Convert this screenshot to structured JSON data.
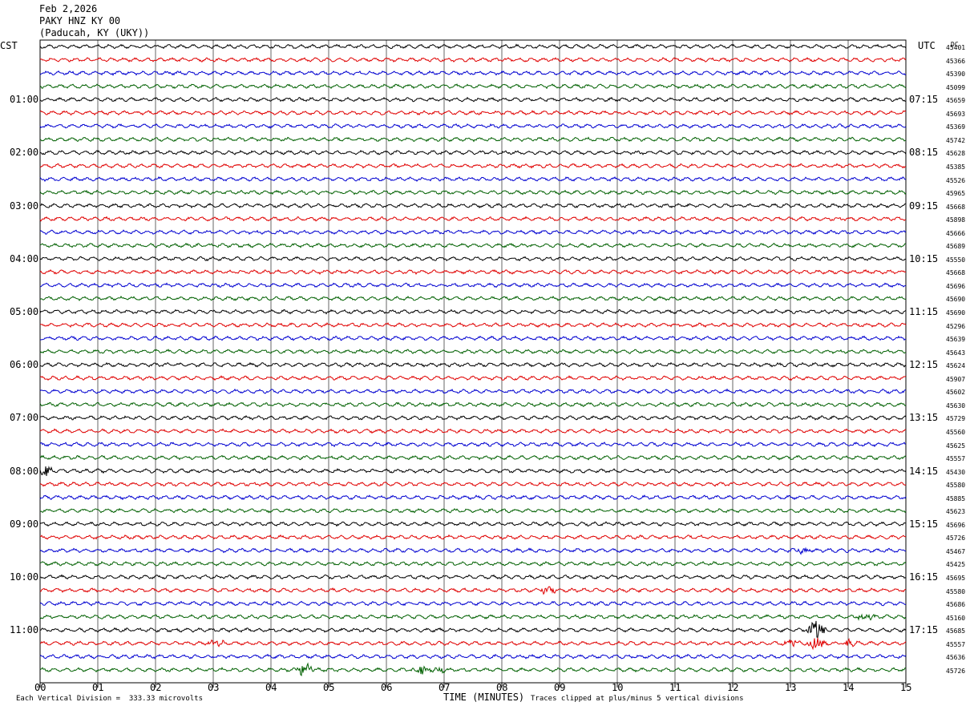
{
  "header": {
    "date": "Feb 2,2026",
    "station": "PAKY HNZ KY 00",
    "location": "(Paducah, KY (UKY))"
  },
  "left_timezone": "CST",
  "right_timezone": "UTC",
  "dc_title": "DC",
  "footer": {
    "scale_note": "Each Vertical Division =  333.33 microvolts",
    "clip_note": "Traces clipped at plus/minus 5 vertical divisions"
  },
  "chart_data": {
    "type": "line",
    "title": "PAKY HNZ KY 00",
    "xlabel": "TIME (MINUTES)",
    "ylabel": "",
    "xlim": [
      0,
      15
    ],
    "x_ticks": [
      "00",
      "01",
      "02",
      "03",
      "04",
      "05",
      "06",
      "07",
      "08",
      "09",
      "10",
      "11",
      "12",
      "13",
      "14",
      "15"
    ],
    "left_hour_labels": [
      "01:00",
      "02:00",
      "03:00",
      "04:00",
      "05:00",
      "06:00",
      "07:00",
      "08:00",
      "09:00",
      "10:00",
      "11:00"
    ],
    "right_hour_labels": [
      "07:15",
      "08:15",
      "09:15",
      "10:15",
      "11:15",
      "12:15",
      "13:15",
      "14:15",
      "15:15",
      "16:15",
      "17:15"
    ],
    "trace_count": 48,
    "trace_colors": [
      "#000000",
      "#e00000",
      "#0000d0",
      "#006000"
    ],
    "dc_offsets": [
      "45401",
      "45366",
      "45390",
      "45099",
      "45659",
      "45693",
      "45369",
      "45742",
      "45628",
      "45385",
      "45526",
      "45965",
      "45668",
      "45898",
      "45666",
      "45689",
      "45550",
      "45668",
      "45696",
      "45690",
      "45690",
      "45296",
      "45639",
      "45643",
      "45624",
      "45907",
      "45602",
      "45630",
      "45729",
      "45560",
      "45625",
      "45557",
      "45430",
      "45580",
      "45885",
      "45623",
      "45696",
      "45726",
      "45467",
      "45425",
      "45695",
      "45580",
      "45686",
      "45160",
      "45685",
      "45557",
      "45636",
      "45726"
    ],
    "events": [
      {
        "trace": 32,
        "minute": 0.1,
        "amp": 2.2
      },
      {
        "trace": 44,
        "minute": 13.45,
        "amp": 4.5
      },
      {
        "trace": 45,
        "minute": 13.45,
        "amp": 3.5
      },
      {
        "trace": 45,
        "minute": 13.0,
        "amp": 1.8
      },
      {
        "trace": 45,
        "minute": 14.0,
        "amp": 1.6
      },
      {
        "trace": 45,
        "minute": 3.05,
        "amp": 1.3
      },
      {
        "trace": 47,
        "minute": 4.6,
        "amp": 3.0
      },
      {
        "trace": 47,
        "minute": 6.6,
        "amp": 2.0
      },
      {
        "trace": 47,
        "minute": 6.9,
        "amp": 1.5
      },
      {
        "trace": 41,
        "minute": 8.8,
        "amp": 1.6
      },
      {
        "trace": 43,
        "minute": 14.3,
        "amp": 1.6
      },
      {
        "trace": 38,
        "minute": 13.2,
        "amp": 1.4
      }
    ]
  }
}
